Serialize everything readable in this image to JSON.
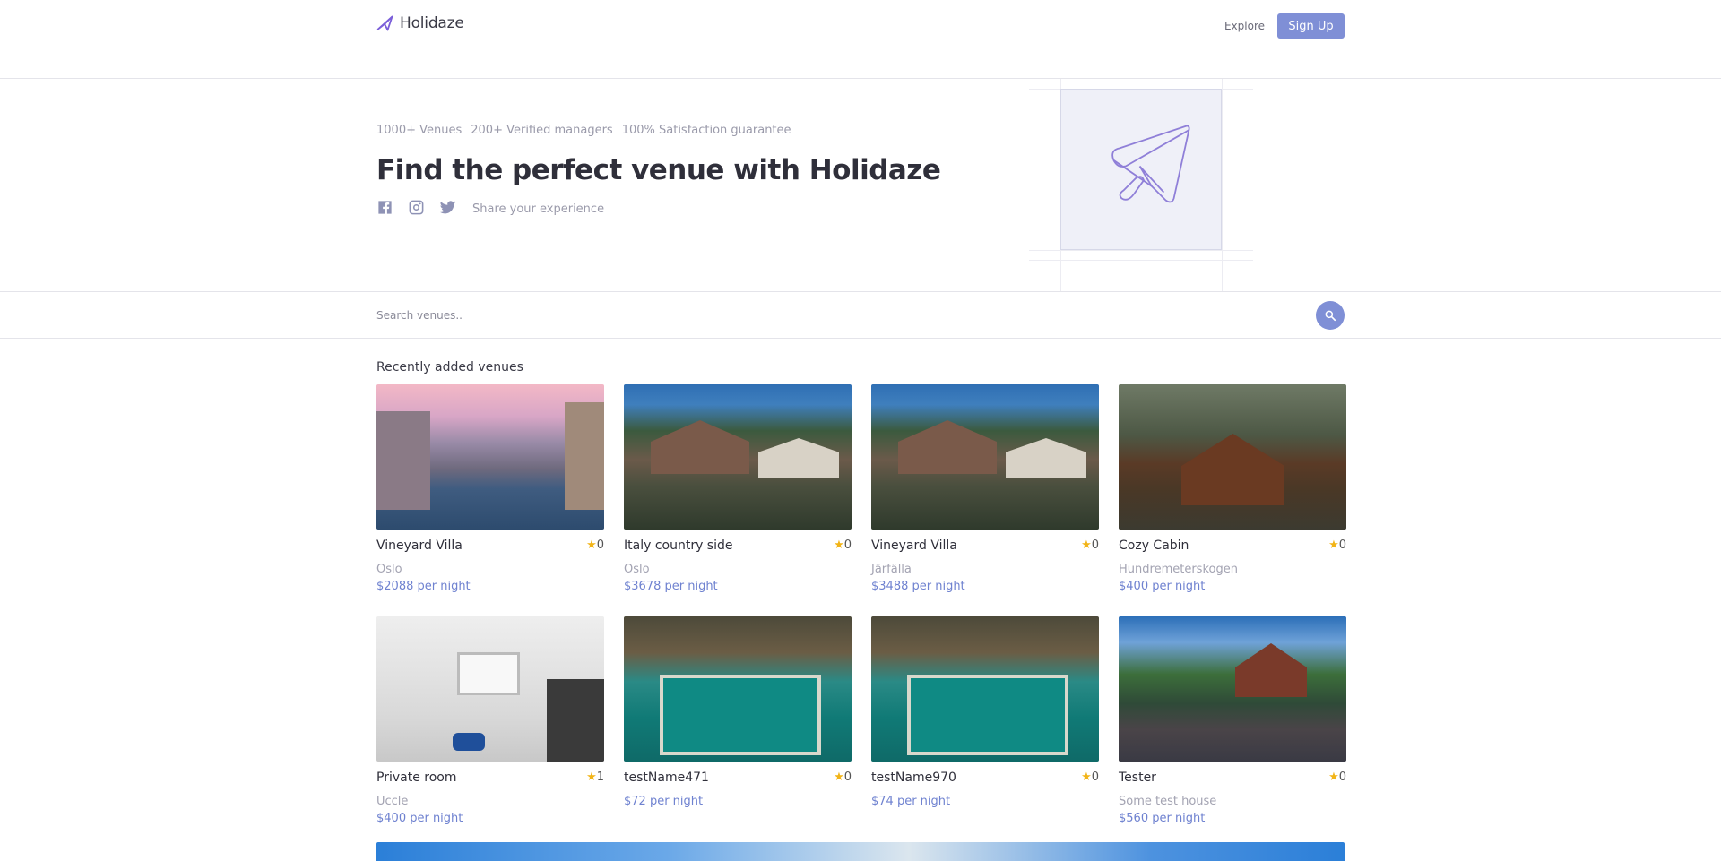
{
  "header": {
    "logo_text": "Holidaze",
    "nav": {
      "explore": "Explore",
      "signup": "Sign Up"
    },
    "accent_color": "#7f8fd6"
  },
  "hero": {
    "stats": [
      "1000+ Venues",
      "200+ Verified managers",
      "100% Satisfaction guarantee"
    ],
    "title": "Find the perfect venue with Holidaze",
    "social_icons": [
      "facebook-icon",
      "instagram-icon",
      "twitter-icon"
    ],
    "share_text": "Share your experience"
  },
  "search": {
    "placeholder": "Search venues.."
  },
  "venues": {
    "section_title": "Recently added venues",
    "items": [
      {
        "name": "Vineyard Villa",
        "rating": "0",
        "location": "Oslo",
        "price": "$2088 per night"
      },
      {
        "name": "Italy country side",
        "rating": "0",
        "location": "Oslo",
        "price": "$3678 per night"
      },
      {
        "name": "Vineyard Villa",
        "rating": "0",
        "location": "Järfälla",
        "price": "$3488 per night"
      },
      {
        "name": "Cozy Cabin",
        "rating": "0",
        "location": "Hundremeterskogen",
        "price": "$400 per night"
      },
      {
        "name": "Private room",
        "rating": "1",
        "location": "Uccle",
        "price": "$400 per night"
      },
      {
        "name": "testName471",
        "rating": "0",
        "location": "",
        "price": "$72 per night"
      },
      {
        "name": "testName970",
        "rating": "0",
        "location": "",
        "price": "$74 per night"
      },
      {
        "name": "Tester",
        "rating": "0",
        "location": "Some test house",
        "price": "$560 per night"
      }
    ]
  }
}
